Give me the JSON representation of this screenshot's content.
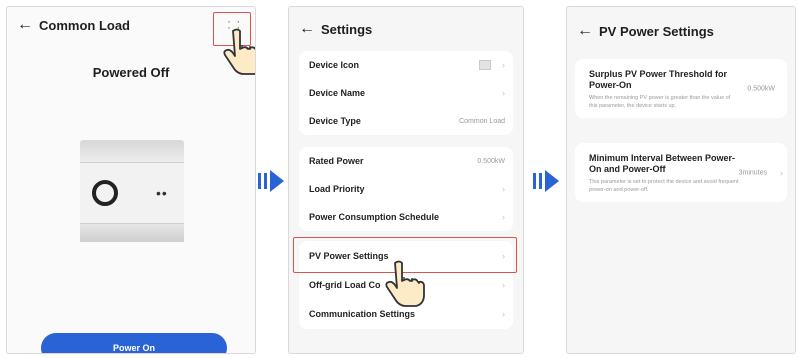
{
  "screen1": {
    "title": "Common Load",
    "status": "Powered Off",
    "power_button": "Power On"
  },
  "screen2": {
    "title": "Settings",
    "group1": [
      {
        "label": "Device Icon",
        "value": ""
      },
      {
        "label": "Device Name",
        "value": ""
      },
      {
        "label": "Device Type",
        "value": "Common Load"
      }
    ],
    "group2": [
      {
        "label": "Rated Power",
        "value": "0.500kW"
      },
      {
        "label": "Load Priority",
        "value": ""
      },
      {
        "label": "Power Consumption Schedule",
        "value": ""
      }
    ],
    "group3": [
      {
        "label": "PV Power Settings"
      },
      {
        "label": "Off-grid Load Co"
      },
      {
        "label": "Communication Settings"
      }
    ]
  },
  "screen3": {
    "title": "PV Power Settings",
    "items": [
      {
        "title": "Surplus PV Power Threshold for Power-On",
        "desc": "When the remaining PV power is greater than the value of this parameter, the device starts up.",
        "value": "0.500kW"
      },
      {
        "title": "Minimum Interval Between Power-On and Power-Off",
        "desc": "This parameter is set to protect the device and avoid frequent power-on and power-off.",
        "value": "3minutes"
      }
    ]
  },
  "colors": {
    "accent": "#2a63d6",
    "highlight": "#d9534f",
    "muted_text": "#9a9a9a"
  },
  "icons": [
    "back-arrow-icon",
    "more-icon",
    "chevron-right-icon",
    "hand-pointer-icon",
    "flow-arrow-icon",
    "device-thumbnail-icon"
  ]
}
